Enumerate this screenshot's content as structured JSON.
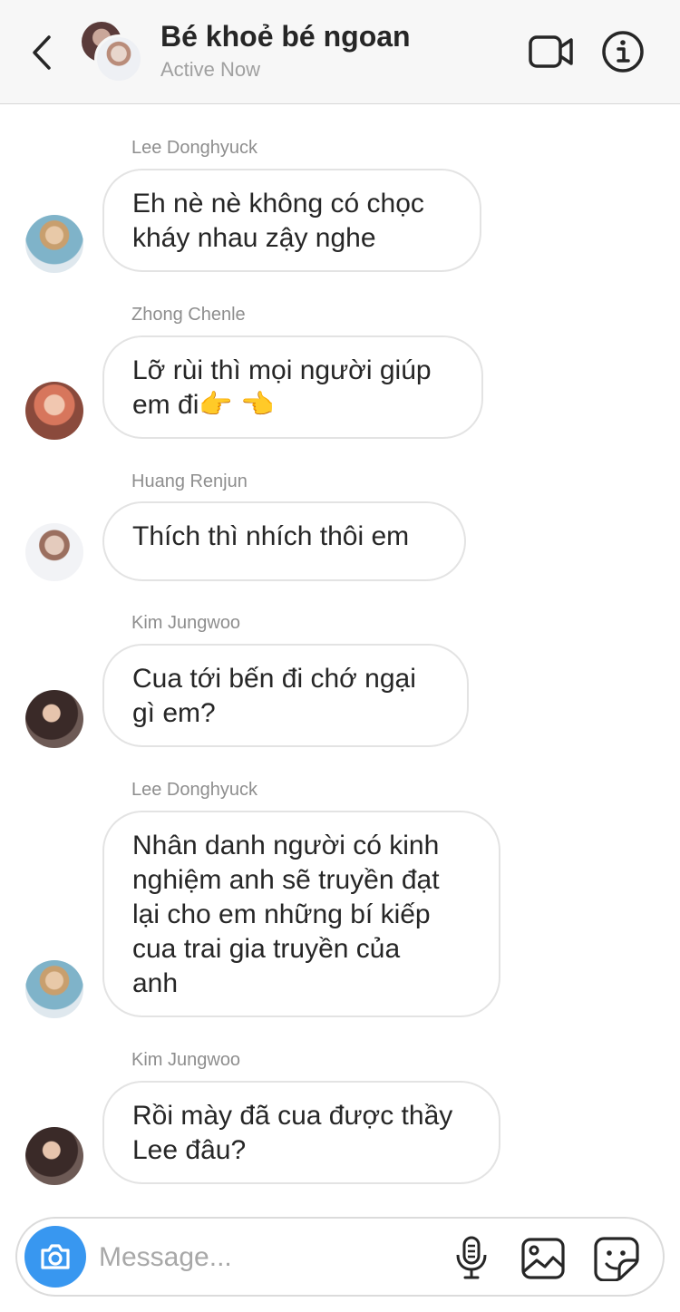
{
  "header": {
    "title": "Bé khoẻ bé ngoan",
    "status": "Active Now"
  },
  "messages": [
    {
      "sender": "Lee Donghyuck",
      "text": "Eh nè nè không có chọc\nkháy nhau zậy nghe",
      "avatar": "donghyuck"
    },
    {
      "sender": "Zhong Chenle",
      "text": "Lỡ rùi thì mọi người giúp\nem đi👉 👈",
      "avatar": "chenle"
    },
    {
      "sender": "Huang Renjun",
      "text": "Thích thì nhích thôi em",
      "avatar": "renjun"
    },
    {
      "sender": "Kim Jungwoo",
      "text": "Cua tới bến đi chớ ngại\ngì em?",
      "avatar": "jungwoo"
    },
    {
      "sender": "Lee Donghyuck",
      "text": "Nhân danh người có kinh\nnghiệm anh sẽ truyền đạt\nlại cho em những bí kiếp\ncua trai gia truyền của\nanh",
      "avatar": "donghyuck"
    },
    {
      "sender": "Kim Jungwoo",
      "text": "Rồi mày đã cua được thầy\nLee đâu?",
      "avatar": "jungwoo"
    }
  ],
  "composer": {
    "placeholder": "Message..."
  },
  "colors": {
    "accent": "#3897f0",
    "bubble_border": "#e3e3e3",
    "meta_text": "#8e8e8e"
  },
  "icons": {
    "back": "chevron-left-icon",
    "video": "video-camera-icon",
    "info": "info-circle-icon",
    "camera": "camera-icon",
    "mic": "microphone-icon",
    "gallery": "image-icon",
    "sticker": "sticker-icon"
  }
}
